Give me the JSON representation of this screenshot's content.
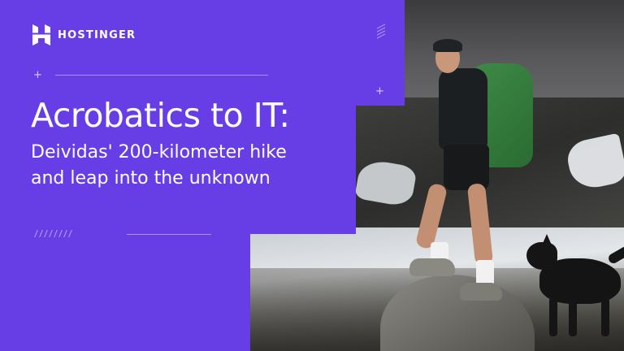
{
  "brand": {
    "name": "HOSTINGER",
    "color": "#673de6",
    "logo_icon": "hostinger-h-icon"
  },
  "headline": {
    "title": "Acrobatics to IT:",
    "subtitle_line1": "Deividas' 200-kilometer hike",
    "subtitle_line2": "and leap into the unknown"
  },
  "photo": {
    "subject": "hiker-with-backpack-and-dog"
  },
  "decorations": {
    "plus_glyph": "+"
  }
}
